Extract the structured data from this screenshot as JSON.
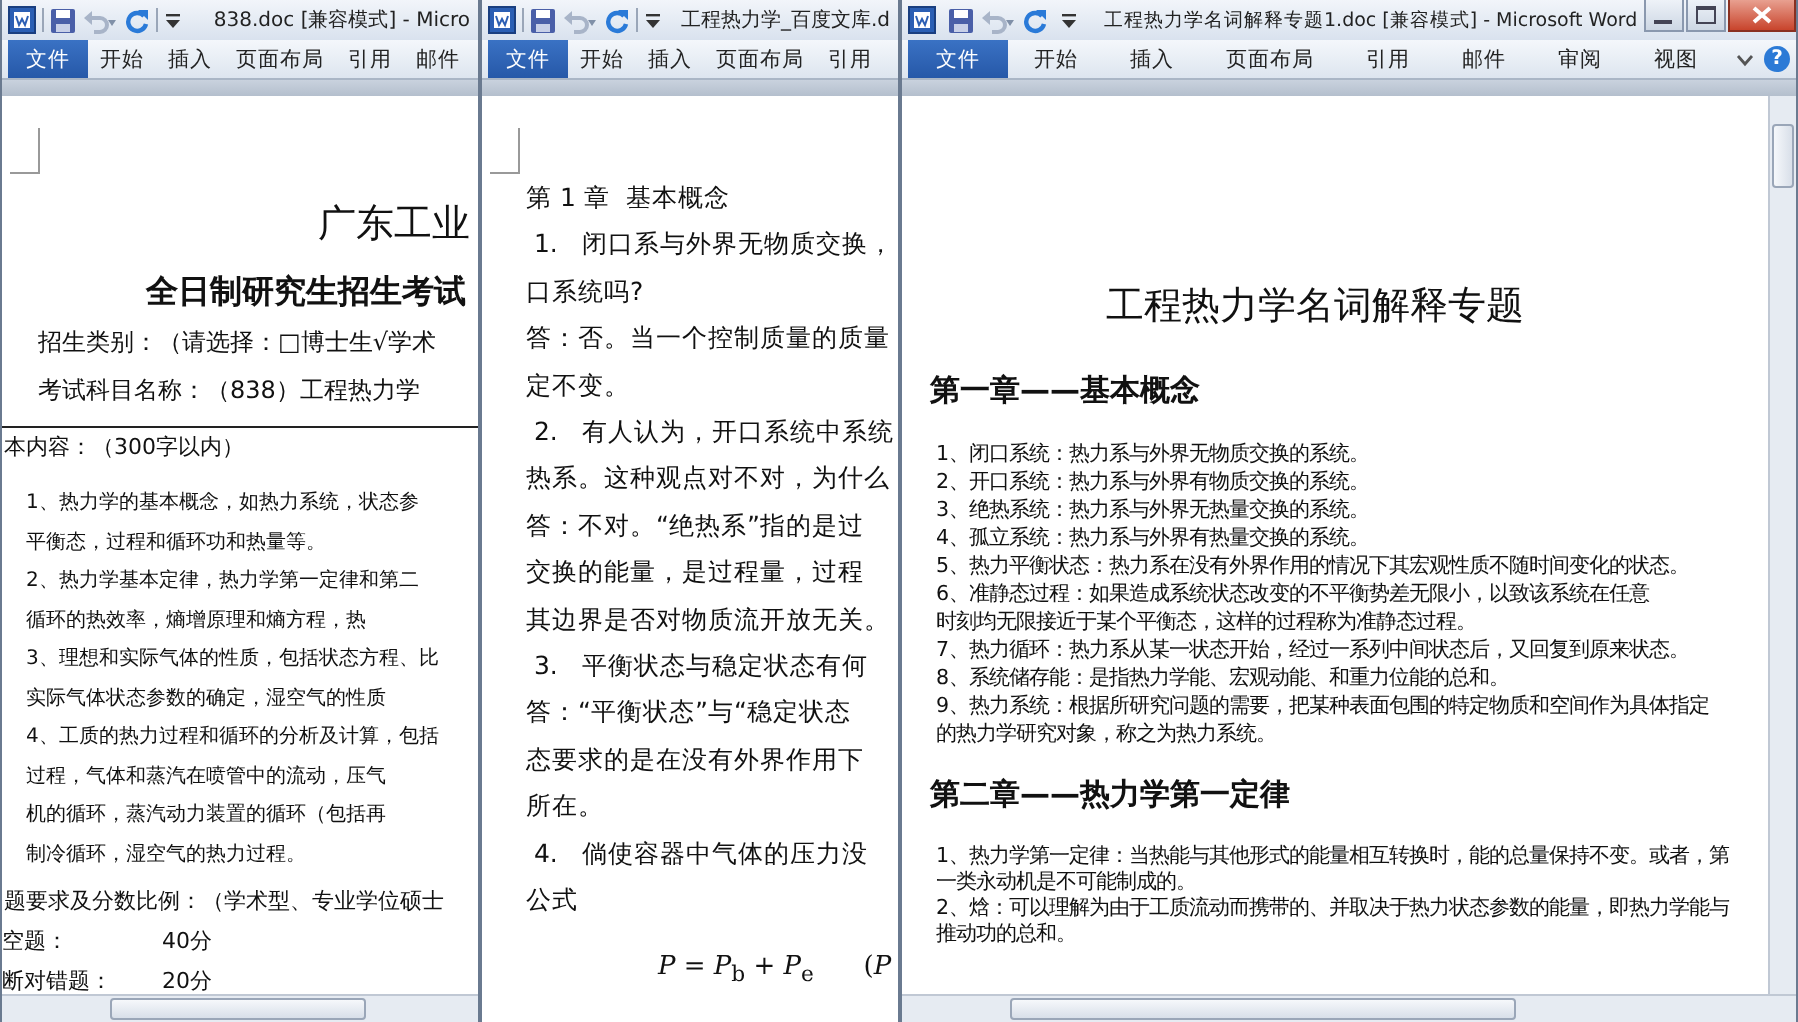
{
  "windows": [
    {
      "kind": "exam",
      "title": "838.doc [兼容模式] - Micro",
      "tabs": [
        {
          "label": "文件",
          "kind": "file"
        },
        {
          "label": "开始",
          "kind": "tab"
        },
        {
          "label": "插入",
          "kind": "tab"
        },
        {
          "label": "页面布局",
          "kind": "tab"
        },
        {
          "label": "引用",
          "kind": "tab"
        },
        {
          "label": "邮件",
          "kind": "tab"
        }
      ],
      "blocks": [
        {
          "kind": "crop-mark"
        },
        {
          "kind": "title",
          "lines": [
            "广东工业"
          ]
        },
        {
          "kind": "subtitle",
          "lines": [
            "全日制研究生招生考试"
          ]
        },
        {
          "kind": "field",
          "lines": [
            "招生类别：（请选择：□博士生√学术"
          ]
        },
        {
          "kind": "field",
          "lines": [
            "考试科目名称：（838）工程热力学"
          ]
        },
        {
          "kind": "section",
          "lines": [
            "本内容：（300字以内）"
          ]
        },
        {
          "kind": "item",
          "lines": [
            "1、热力学的基本概念，如热力系统，状态参",
            "平衡态，过程和循环功和热量等。"
          ]
        },
        {
          "kind": "item",
          "lines": [
            "2、热力学基本定律，热力学第一定律和第二",
            "循环的热效率，熵增原理和熵方程，热"
          ]
        },
        {
          "kind": "item",
          "lines": [
            "3、理想和实际气体的性质，包括状态方程、比",
            "实际气体状态参数的确定，湿空气的性质"
          ]
        },
        {
          "kind": "item",
          "lines": [
            "4、工质的热力过程和循环的分析及计算，包括",
            "过程，气体和蒸汽在喷管中的流动，压气",
            "机的循环，蒸汽动力装置的循环（包括再",
            "制冷循环，湿空气的热力过程。"
          ]
        },
        {
          "kind": "section",
          "lines": [
            "题要求及分数比例：（学术型、专业学位硕士"
          ]
        },
        {
          "kind": "score",
          "label": "空题：",
          "value": "40分"
        },
        {
          "kind": "score",
          "label": "断对错题：",
          "value": "20分"
        }
      ]
    },
    {
      "kind": "qa",
      "title": "工程热力学_百度文库.d",
      "tabs": [
        {
          "label": "文件",
          "kind": "file"
        },
        {
          "label": "开始",
          "kind": "tab"
        },
        {
          "label": "插入",
          "kind": "tab"
        },
        {
          "label": "页面布局",
          "kind": "tab"
        },
        {
          "label": "引用",
          "kind": "tab"
        }
      ],
      "blocks": [
        {
          "kind": "crop-mark"
        },
        {
          "kind": "chapter",
          "lines": [
            "第 1 章  基本概念"
          ]
        },
        {
          "kind": "para",
          "lines": [
            " 1.   闭口系与外界无物质交换，",
            "口系统吗?"
          ]
        },
        {
          "kind": "para",
          "lines": [
            "答：否。当一个控制质量的质量",
            "定不变。"
          ]
        },
        {
          "kind": "para",
          "lines": [
            " 2.   有人认为，开口系统中系统",
            "热系。这种观点对不对，为什么"
          ]
        },
        {
          "kind": "para",
          "lines": [
            "答：不对。“绝热系”指的是过",
            "交换的能量，是过程量，过程",
            "其边界是否对物质流开放无关。"
          ]
        },
        {
          "kind": "para",
          "lines": [
            " 3.   平衡状态与稳定状态有何"
          ]
        },
        {
          "kind": "para",
          "lines": [
            "答：“平衡状态”与“稳定状态",
            "态要求的是在没有外界作用下",
            "所在。"
          ]
        },
        {
          "kind": "para",
          "lines": [
            " 4.   倘使容器中气体的压力没",
            "公式"
          ]
        },
        {
          "kind": "formula",
          "text": "*P* = *P*$_{b}$ + *P*$_{e}$      (*P*"
        }
      ]
    },
    {
      "kind": "glossary",
      "title": "工程热力学名词解释专题1.doc [兼容模式] - Microsoft Word",
      "caption_buttons": true,
      "help_label": "?",
      "tabs": [
        {
          "label": "文件",
          "kind": "file"
        },
        {
          "label": "开始",
          "kind": "tab"
        },
        {
          "label": "插入",
          "kind": "tab"
        },
        {
          "label": "页面布局",
          "kind": "tab"
        },
        {
          "label": "引用",
          "kind": "tab"
        },
        {
          "label": "邮件",
          "kind": "tab"
        },
        {
          "label": "审阅",
          "kind": "tab"
        },
        {
          "label": "视图",
          "kind": "tab"
        }
      ],
      "blocks": [
        {
          "kind": "doc-title",
          "lines": [
            "工程热力学名词解释专题"
          ]
        },
        {
          "kind": "heading",
          "lines": [
            "第一章——基本概念"
          ]
        },
        {
          "kind": "list",
          "items": [
            {
              "lines": [
                "1、闭口系统：热力系与外界无物质交换的系统。"
              ]
            },
            {
              "lines": [
                "2、开口系统：热力系与外界有物质交换的系统。"
              ]
            },
            {
              "lines": [
                "3、绝热系统：热力系与外界无热量交换的系统。"
              ]
            },
            {
              "lines": [
                "4、孤立系统：热力系与外界有热量交换的系统。"
              ]
            },
            {
              "lines": [
                "5、热力平衡状态：热力系在没有外界作用的情况下其宏观性质不随时间变化的状态。"
              ]
            },
            {
              "lines": [
                "6、准静态过程：如果造成系统状态改变的不平衡势差无限小，以致该系统在任意",
                "时刻均无限接近于某个平衡态，这样的过程称为准静态过程。"
              ]
            },
            {
              "lines": [
                "7、热力循环：热力系从某一状态开始，经过一系列中间状态后，又回复到原来状态。"
              ]
            },
            {
              "lines": [
                "8、系统储存能：是指热力学能、宏观动能、和重力位能的总和。"
              ]
            },
            {
              "lines": [
                "9、热力系统：根据所研究问题的需要，把某种表面包围的特定物质和空间作为具体指定",
                "的热力学研究对象，称之为热力系统。"
              ]
            }
          ]
        },
        {
          "kind": "heading",
          "lines": [
            "第二章——热力学第一定律"
          ]
        },
        {
          "kind": "list",
          "items": [
            {
              "lines": [
                "1、热力学第一定律：当热能与其他形式的能量相互转换时，能的总量保持不变。或者，第",
                "一类永动机是不可能制成的。"
              ]
            },
            {
              "lines": [
                "2、焓：可以理解为由于工质流动而携带的、并取决于热力状态参数的能量，即热力学能与",
                "推动功的总和。"
              ]
            }
          ]
        }
      ]
    }
  ]
}
